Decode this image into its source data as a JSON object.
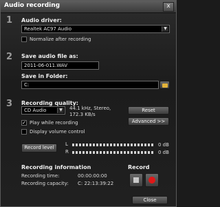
{
  "window": {
    "title": "Audio recording",
    "close_glyph": "x"
  },
  "section1": {
    "step": "1",
    "driver_label": "Audio driver:",
    "driver_value": "Realtek AC97 Audio",
    "normalize_label": "Normalize after recording",
    "normalize_checked": false
  },
  "section2": {
    "step": "2",
    "filename_label": "Save audio file as:",
    "filename_value": "2011-06-011.WAV",
    "folder_label": "Save in Folder:",
    "folder_value": "C:"
  },
  "section3": {
    "step": "3",
    "quality_label": "Recording quality:",
    "quality_value": "CD Audio",
    "quality_info_line1": "44.1 kHz, Stereo,",
    "quality_info_line2": "172.3 KB/s",
    "reset_label": "Reset",
    "advanced_label": "Advanced >>",
    "play_label": "Play while recording",
    "play_checked": true,
    "volume_label": "Display volume control",
    "volume_checked": false,
    "record_level_label": "Record level",
    "meter_left_letter": "L",
    "meter_right_letter": "R",
    "meter_left_db": "0 dB",
    "meter_right_db": "0 dB"
  },
  "info": {
    "heading": "Recording information",
    "time_label": "Recording time:",
    "time_value": "00:00:00:00",
    "capacity_label": "Recording capacity:",
    "capacity_value": "C: 22:13:39:22"
  },
  "record": {
    "heading": "Record"
  },
  "footer": {
    "close_label": "Close"
  },
  "colors": {
    "record_red": "#e01818",
    "folder_yellow": "#e2b23a"
  },
  "icons": {
    "dropdown": "chevron-down-icon",
    "folder": "folder-icon",
    "stop": "stop-icon",
    "record": "record-icon"
  }
}
